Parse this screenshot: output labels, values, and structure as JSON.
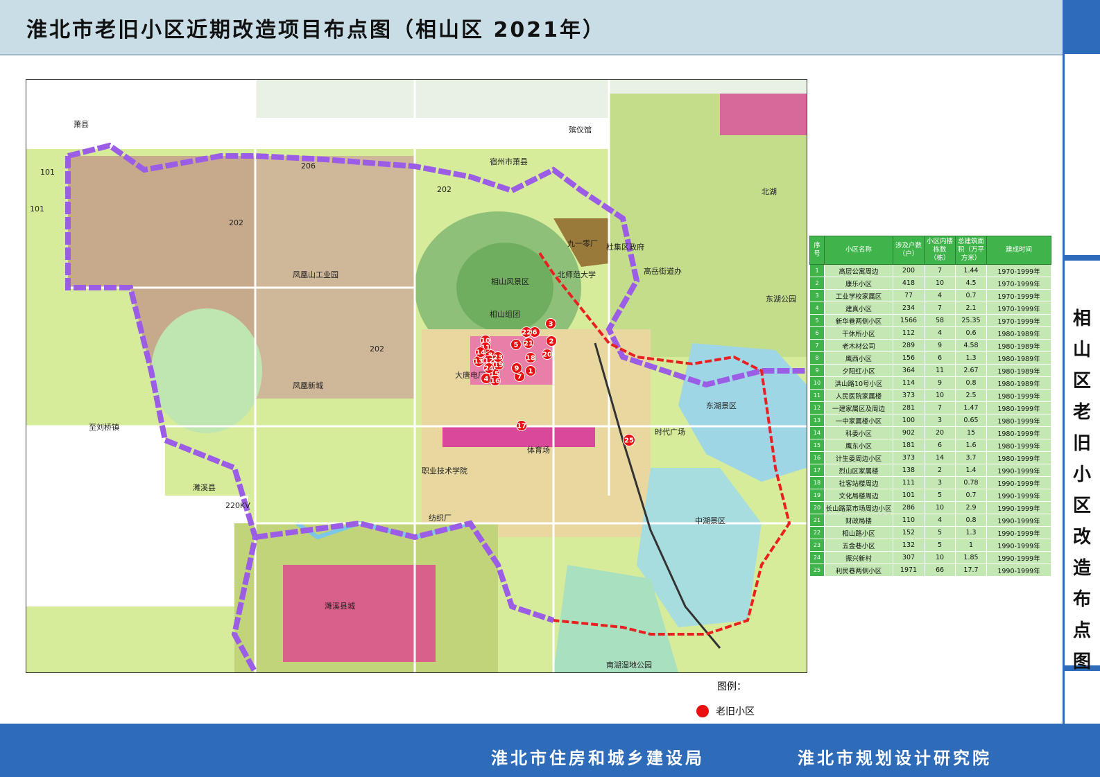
{
  "header": {
    "title": "淮北市老旧小区近期改造项目布点图（相山区 2021年）"
  },
  "side_title": "相山区老旧小区改造布点图",
  "map": {
    "place_labels": [
      "萧县",
      "宿州市萧县",
      "殡仪馆",
      "九一零厂",
      "北师范大学",
      "相山风景区",
      "相山组团",
      "凤凰山工业园",
      "凤凰新城",
      "大唐电厂",
      "体育场",
      "职业技术学院",
      "纺织厂",
      "时代广场",
      "东湖景区",
      "中湖景区",
      "南湖湿地公园",
      "濉溪县",
      "濉溪县城",
      "至刘桥镇",
      "220KV",
      "杜集区政府",
      "高岳街道办",
      "北湖",
      "东湖公园"
    ],
    "road_numbers": [
      "101",
      "101",
      "202",
      "202",
      "202",
      "206"
    ],
    "markers": [
      {
        "n": "1"
      },
      {
        "n": "2"
      },
      {
        "n": "3"
      },
      {
        "n": "4"
      },
      {
        "n": "5"
      },
      {
        "n": "6"
      },
      {
        "n": "7"
      },
      {
        "n": "8"
      },
      {
        "n": "9"
      },
      {
        "n": "10"
      },
      {
        "n": "11"
      },
      {
        "n": "12"
      },
      {
        "n": "13"
      },
      {
        "n": "14"
      },
      {
        "n": "15"
      },
      {
        "n": "16"
      },
      {
        "n": "17"
      },
      {
        "n": "18"
      },
      {
        "n": "19"
      },
      {
        "n": "20"
      },
      {
        "n": "21"
      },
      {
        "n": "22"
      },
      {
        "n": "23"
      },
      {
        "n": "24"
      },
      {
        "n": "25"
      }
    ]
  },
  "table": {
    "headers": [
      "序号",
      "小区名称",
      "涉及户数（户）",
      "小区内楼栋数（栋）",
      "总建筑面积（万平方米）",
      "建成时间"
    ],
    "rows": [
      [
        "1",
        "高层公寓周边",
        "200",
        "7",
        "1.44",
        "1970-1999年"
      ],
      [
        "2",
        "康乐小区",
        "418",
        "10",
        "4.5",
        "1970-1999年"
      ],
      [
        "3",
        "工业学校家属区",
        "77",
        "4",
        "0.7",
        "1970-1999年"
      ],
      [
        "4",
        "建真小区",
        "234",
        "7",
        "2.1",
        "1970-1999年"
      ],
      [
        "5",
        "新华巷两侧小区",
        "1566",
        "58",
        "25.35",
        "1970-1999年"
      ],
      [
        "6",
        "干休所小区",
        "112",
        "4",
        "0.6",
        "1980-1989年"
      ],
      [
        "7",
        "老木材公司",
        "289",
        "9",
        "4.58",
        "1980-1989年"
      ],
      [
        "8",
        "鹰西小区",
        "156",
        "6",
        "1.3",
        "1980-1989年"
      ],
      [
        "9",
        "夕阳红小区",
        "364",
        "11",
        "2.67",
        "1980-1989年"
      ],
      [
        "10",
        "洪山路10号小区",
        "114",
        "9",
        "0.8",
        "1980-1989年"
      ],
      [
        "11",
        "人民医院家属楼",
        "373",
        "10",
        "2.5",
        "1980-1999年"
      ],
      [
        "12",
        "一建家属区及周边",
        "281",
        "7",
        "1.47",
        "1980-1999年"
      ],
      [
        "13",
        "一中家属楼小区",
        "100",
        "3",
        "0.65",
        "1980-1999年"
      ],
      [
        "14",
        "科委小区",
        "902",
        "20",
        "15",
        "1980-1999年"
      ],
      [
        "15",
        "鹰东小区",
        "181",
        "6",
        "1.6",
        "1980-1999年"
      ],
      [
        "16",
        "计生委周边小区",
        "373",
        "14",
        "3.7",
        "1980-1999年"
      ],
      [
        "17",
        "烈山区家属楼",
        "138",
        "2",
        "1.4",
        "1990-1999年"
      ],
      [
        "18",
        "社客站楼周边",
        "111",
        "3",
        "0.78",
        "1990-1999年"
      ],
      [
        "19",
        "文化局楼周边",
        "101",
        "5",
        "0.7",
        "1990-1999年"
      ],
      [
        "20",
        "长山路菜市场周边小区",
        "286",
        "10",
        "2.9",
        "1990-1999年"
      ],
      [
        "21",
        "财政局楼",
        "110",
        "4",
        "0.8",
        "1990-1999年"
      ],
      [
        "22",
        "相山路小区",
        "152",
        "5",
        "1.3",
        "1990-1999年"
      ],
      [
        "23",
        "五金巷小区",
        "132",
        "5",
        "1",
        "1990-1999年"
      ],
      [
        "24",
        "振兴新村",
        "307",
        "10",
        "1.85",
        "1990-1999年"
      ],
      [
        "25",
        "利民巷两侧小区",
        "1971",
        "66",
        "17.7",
        "1990-1999年"
      ]
    ]
  },
  "legend": {
    "title": "图例：",
    "item": "老旧小区",
    "color": "#e81010"
  },
  "footer": {
    "org_left": "淮北市住房和城乡建设局",
    "org_right": "淮北市规划设计研究院"
  },
  "colors": {
    "boundary": "#9b5de5",
    "district_boundary": "#e82020",
    "header_bg": "#c9dde6",
    "brand_blue": "#2e6bb8",
    "table_green": "#3eb44a"
  }
}
